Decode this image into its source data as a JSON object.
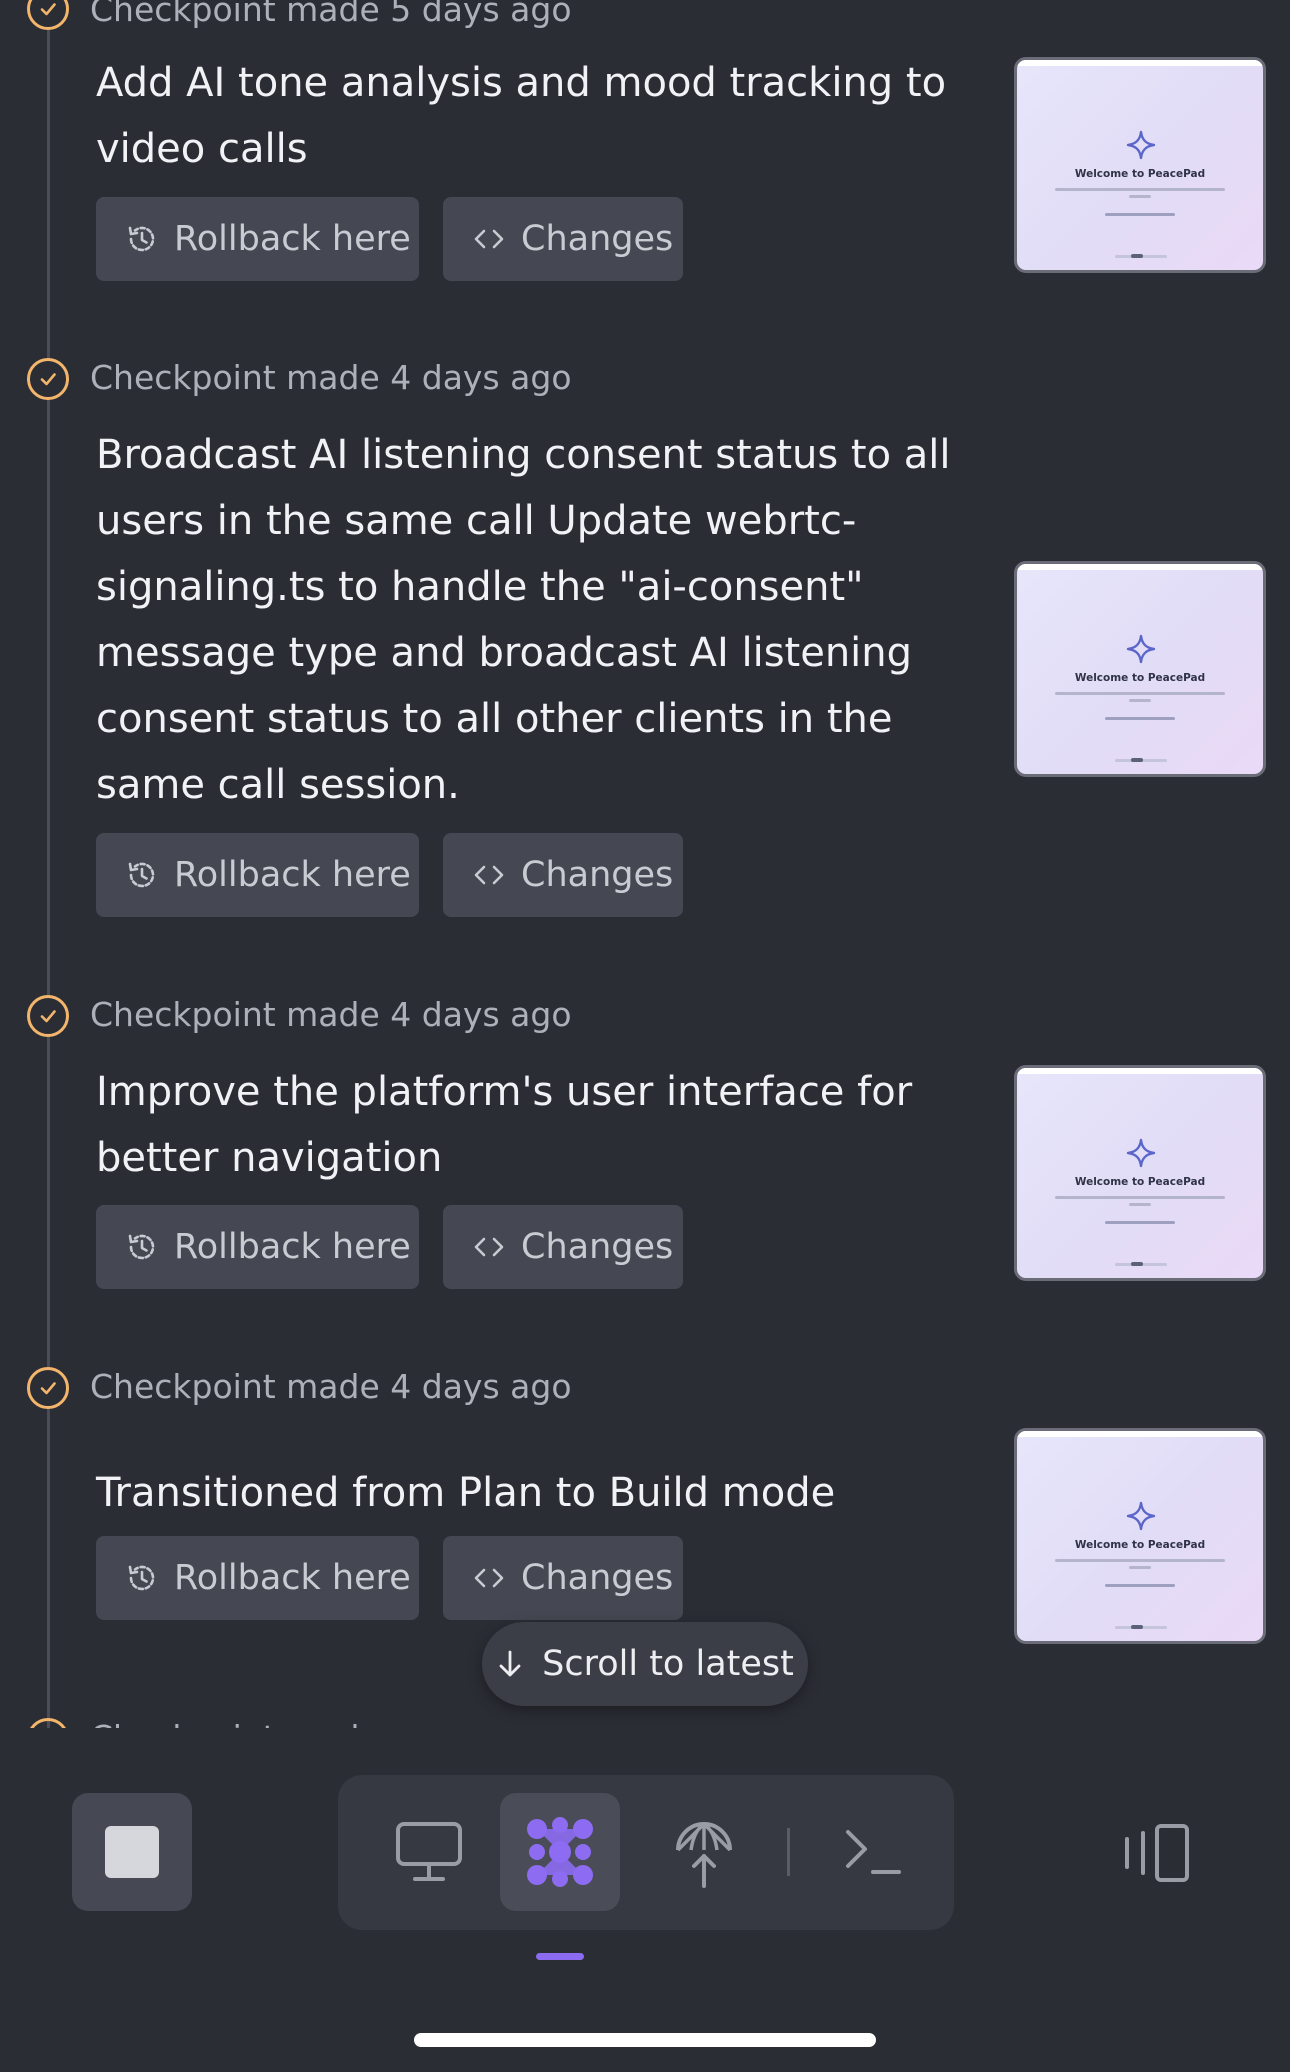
{
  "colors": {
    "background": "#2b2d35",
    "checkpoint_accent": "#f2b56b",
    "button_bg": "#454852",
    "active_indicator": "#8b6cf0"
  },
  "checkpoints": [
    {
      "label": "Checkpoint made",
      "time": "5 days ago",
      "title": "Add AI tone analysis and mood tracking to video calls",
      "rollback_label": "Rollback here",
      "changes_label": "Changes",
      "thumbnail_title": "Welcome to PeacePad"
    },
    {
      "label": "Checkpoint made",
      "time": "4 days ago",
      "title": "Broadcast AI listening consent status to all users in the same call Update webrtc-signaling.ts to handle the \"ai-consent\" message type and broadcast AI listening consent status to all other clients in the same call session.",
      "rollback_label": "Rollback here",
      "changes_label": "Changes",
      "thumbnail_title": "Welcome to PeacePad"
    },
    {
      "label": "Checkpoint made",
      "time": "4 days ago",
      "title": "Improve the platform's user interface for better navigation",
      "rollback_label": "Rollback here",
      "changes_label": "Changes",
      "thumbnail_title": "Welcome to PeacePad"
    },
    {
      "label": "Checkpoint made",
      "time": "4 days ago",
      "title": "Transitioned from Plan to Build mode",
      "rollback_label": "Rollback here",
      "changes_label": "Changes",
      "thumbnail_title": "Welcome to PeacePad"
    }
  ],
  "scroll_to_latest": "Scroll to latest",
  "bottom_bar": {
    "stop_icon": "stop-icon",
    "tools": [
      {
        "icon": "monitor-icon",
        "name": "preview"
      },
      {
        "icon": "agent-icon",
        "name": "agent",
        "active": true
      },
      {
        "icon": "deploy-icon",
        "name": "deploy"
      },
      {
        "icon": "terminal-icon",
        "name": "shell"
      }
    ],
    "panel_icon": "panel-toggle-icon"
  }
}
